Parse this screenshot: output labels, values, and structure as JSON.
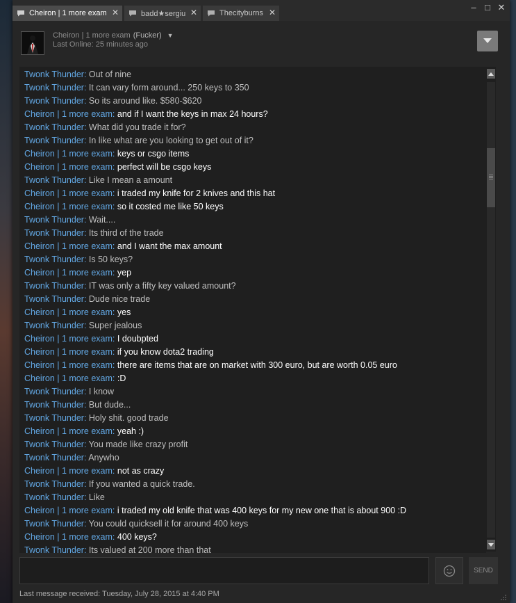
{
  "tabs": [
    {
      "label": "Cheiron | 1 more exam",
      "active": true
    },
    {
      "label": "badd★sergiu",
      "active": false
    },
    {
      "label": "Thecityburns",
      "active": false
    }
  ],
  "window_controls": {
    "minimize": "–",
    "maximize": "□",
    "close": "✕"
  },
  "header": {
    "friend_name": "Cheiron | 1 more exam",
    "nickname": "(Fucker)",
    "last_online": "Last Online: 25 minutes ago"
  },
  "messages": [
    {
      "sender": "Twonk Thunder",
      "me": false,
      "text": "Out of nine"
    },
    {
      "sender": "Twonk Thunder",
      "me": false,
      "text": "It can vary form around... 250 keys to 350"
    },
    {
      "sender": "Twonk Thunder",
      "me": false,
      "text": "So its around like. $580-$620"
    },
    {
      "sender": "Cheiron | 1 more exam",
      "me": true,
      "text": "and if I want the keys in max 24 hours?"
    },
    {
      "sender": "Twonk Thunder",
      "me": false,
      "text": "What did you trade it for?"
    },
    {
      "sender": "Twonk Thunder",
      "me": false,
      "text": "In like what are you looking to get out of it?"
    },
    {
      "sender": "Cheiron | 1 more exam",
      "me": true,
      "text": "keys or csgo items"
    },
    {
      "sender": "Cheiron | 1 more exam",
      "me": true,
      "text": "perfect will be csgo keys"
    },
    {
      "sender": "Twonk Thunder",
      "me": false,
      "text": "Like I mean a amount"
    },
    {
      "sender": "Cheiron | 1 more exam",
      "me": true,
      "text": "i traded my knife for 2 knives and this hat"
    },
    {
      "sender": "Cheiron | 1 more exam",
      "me": true,
      "text": "so it costed me like 50 keys"
    },
    {
      "sender": "Twonk Thunder",
      "me": false,
      "text": "Wait...."
    },
    {
      "sender": "Twonk Thunder",
      "me": false,
      "text": "Its third of the trade"
    },
    {
      "sender": "Cheiron | 1 more exam",
      "me": true,
      "text": "and I want the max amount"
    },
    {
      "sender": "Twonk Thunder",
      "me": false,
      "text": "Is 50 keys?"
    },
    {
      "sender": "Cheiron | 1 more exam",
      "me": true,
      "text": "yep"
    },
    {
      "sender": "Twonk Thunder",
      "me": false,
      "text": "IT was only a fifty key valued amount?"
    },
    {
      "sender": "Twonk Thunder",
      "me": false,
      "text": "Dude nice trade"
    },
    {
      "sender": "Cheiron | 1 more exam",
      "me": true,
      "text": "yes"
    },
    {
      "sender": "Twonk Thunder",
      "me": false,
      "text": "Super jealous"
    },
    {
      "sender": "Cheiron | 1 more exam",
      "me": true,
      "text": "I doubpted"
    },
    {
      "sender": "Cheiron | 1 more exam",
      "me": true,
      "text": "if you know dota2 trading"
    },
    {
      "sender": "Cheiron | 1 more exam",
      "me": true,
      "text": "there are items that are on market with 300 euro, but are worth 0.05 euro"
    },
    {
      "sender": "Cheiron | 1 more exam",
      "me": true,
      "text": ":D"
    },
    {
      "sender": "Twonk Thunder",
      "me": false,
      "text": "I know"
    },
    {
      "sender": "Twonk Thunder",
      "me": false,
      "text": "But dude..."
    },
    {
      "sender": "Twonk Thunder",
      "me": false,
      "text": "Holy shit. good trade"
    },
    {
      "sender": "Cheiron | 1 more exam",
      "me": true,
      "text": "yeah :)"
    },
    {
      "sender": "Twonk Thunder",
      "me": false,
      "text": "You made like crazy profit"
    },
    {
      "sender": "Twonk Thunder",
      "me": false,
      "text": "Anywho"
    },
    {
      "sender": "Cheiron | 1 more exam",
      "me": true,
      "text": "not as crazy"
    },
    {
      "sender": "Twonk Thunder",
      "me": false,
      "text": "If you wanted a quick trade."
    },
    {
      "sender": "Twonk Thunder",
      "me": false,
      "text": "Like"
    },
    {
      "sender": "Cheiron | 1 more exam",
      "me": true,
      "text": "i traded my old knife that was 400 keys for my new one that is about 900 :D"
    },
    {
      "sender": "Twonk Thunder",
      "me": false,
      "text": "You could quicksell it for around 400 keys"
    },
    {
      "sender": "Cheiron | 1 more exam",
      "me": true,
      "text": "400 keys?"
    },
    {
      "sender": "Twonk Thunder",
      "me": false,
      "text": "Its valued at 200 more than that"
    }
  ],
  "input": {
    "value": ""
  },
  "send_label": "SEND",
  "status": "Last message received: Tuesday, July 28, 2015 at 4:40 PM",
  "colors": {
    "sender": "#62a7e3",
    "my_text": "#ffffff",
    "their_text": "#bfbfbf"
  },
  "icons": [
    "chat-bubble-icon",
    "close-icon",
    "minimize-icon",
    "maximize-icon",
    "caret-down-icon",
    "dropdown-arrow-icon",
    "scroll-up-icon",
    "scroll-down-icon",
    "emoticon-icon",
    "resize-grip-icon"
  ]
}
